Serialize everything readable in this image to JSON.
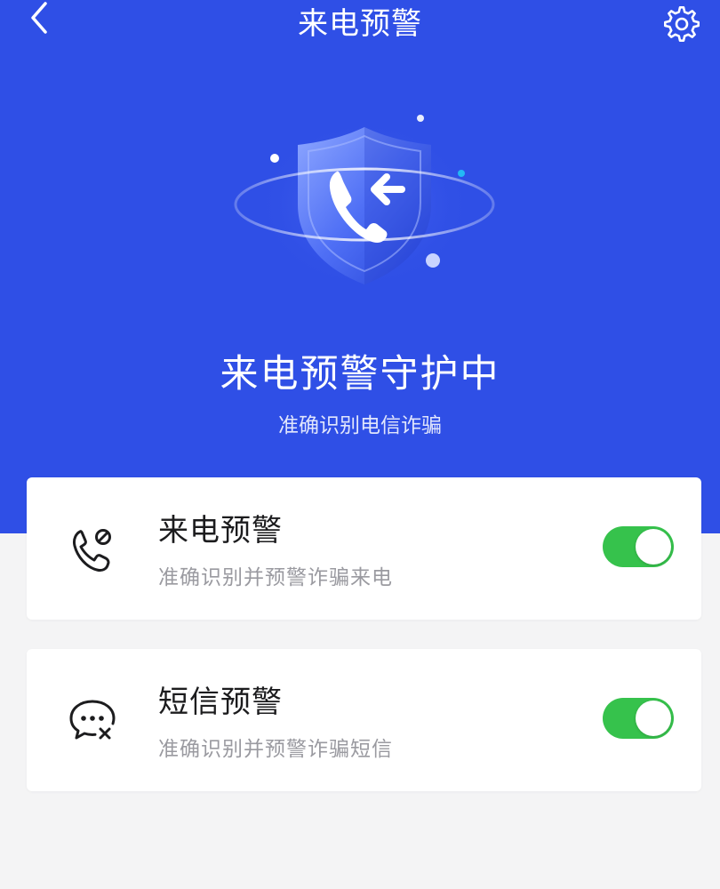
{
  "header": {
    "title": "来电预警",
    "back_icon": "chevron-left-icon",
    "settings_icon": "gear-icon"
  },
  "hero": {
    "illustration": "shield-incoming-call-icon",
    "status_title": "来电预警守护中",
    "status_subtitle": "准确识别电信诈骗"
  },
  "settings": [
    {
      "title": "来电预警",
      "description": "准确识别并预警诈骗来电",
      "icon": "phone-block-icon",
      "enabled": true
    },
    {
      "title": "短信预警",
      "description": "准确识别并预警诈骗短信",
      "icon": "message-block-icon",
      "enabled": true
    }
  ],
  "colors": {
    "primary_blue": "#2f4fe6",
    "toggle_on": "#36c24c",
    "background": "#f4f4f5",
    "text_primary": "#1c1c1e",
    "text_secondary": "#9a9aa0"
  }
}
